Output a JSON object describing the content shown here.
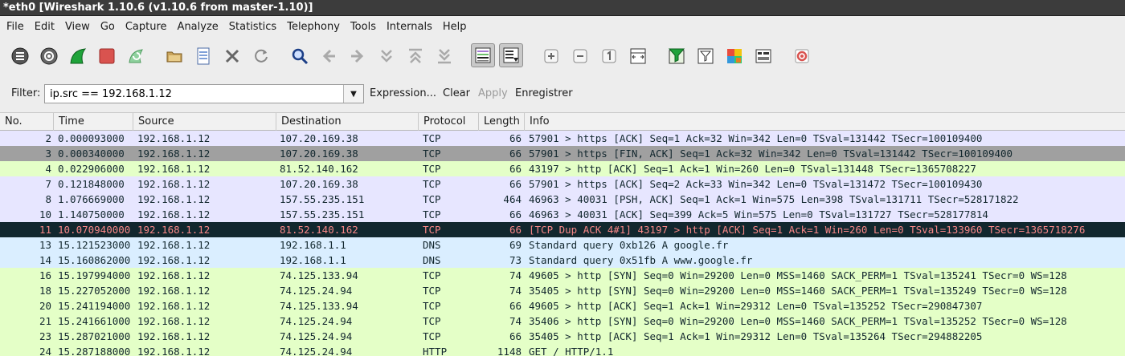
{
  "window": {
    "title": "*eth0   [Wireshark 1.10.6  (v1.10.6 from master-1.10)]"
  },
  "menu": [
    "File",
    "Edit",
    "View",
    "Go",
    "Capture",
    "Analyze",
    "Statistics",
    "Telephony",
    "Tools",
    "Internals",
    "Help"
  ],
  "toolbar": {
    "icons": [
      "interfaces-icon",
      "options-icon",
      "start-capture-icon",
      "stop-capture-icon",
      "restart-capture-icon",
      "open-file-icon",
      "save-file-icon",
      "close-file-icon",
      "reload-icon",
      "find-packet-icon",
      "go-back-icon",
      "go-forward-icon",
      "go-to-packet-icon",
      "go-first-icon",
      "go-last-icon",
      "colorize-icon",
      "autoscroll-icon",
      "zoom-in-icon",
      "zoom-out-icon",
      "normal-size-icon",
      "resize-columns-icon",
      "capture-filters-icon",
      "display-filters-icon",
      "coloring-rules-icon",
      "preferences-icon",
      "help-icon"
    ]
  },
  "filter": {
    "label": "Filter:",
    "value": "ip.src == 192.168.1.12",
    "expression_label": "Expression...",
    "clear_label": "Clear",
    "apply_label": "Apply",
    "save_label": "Enregistrer"
  },
  "packet_list": {
    "columns": [
      "No.",
      "Time",
      "Source",
      "Destination",
      "Protocol",
      "Length",
      "Info"
    ],
    "rows": [
      {
        "no": "2",
        "time": "0.000093000",
        "src": "192.168.1.12",
        "dst": "107.20.169.38",
        "proto": "TCP",
        "len": "66",
        "info": "57901 > https [ACK] Seq=1 Ack=32 Win=342 Len=0 TSval=131442 TSecr=100109400",
        "bg": "#e7e6ff",
        "fg": "#12272e"
      },
      {
        "no": "3",
        "time": "0.000340000",
        "src": "192.168.1.12",
        "dst": "107.20.169.38",
        "proto": "TCP",
        "len": "66",
        "info": "57901 > https [FIN, ACK] Seq=1 Ack=32 Win=342 Len=0 TSval=131442 TSecr=100109400",
        "bg": "#a0a0a0",
        "fg": "#12272e"
      },
      {
        "no": "4",
        "time": "0.022906000",
        "src": "192.168.1.12",
        "dst": "81.52.140.162",
        "proto": "TCP",
        "len": "66",
        "info": "43197 > http [ACK] Seq=1 Ack=1 Win=260 Len=0 TSval=131448 TSecr=1365708227",
        "bg": "#e4ffc7",
        "fg": "#12272e"
      },
      {
        "no": "7",
        "time": "0.121848000",
        "src": "192.168.1.12",
        "dst": "107.20.169.38",
        "proto": "TCP",
        "len": "66",
        "info": "57901 > https [ACK] Seq=2 Ack=33 Win=342 Len=0 TSval=131472 TSecr=100109430",
        "bg": "#e7e6ff",
        "fg": "#12272e"
      },
      {
        "no": "8",
        "time": "1.076669000",
        "src": "192.168.1.12",
        "dst": "157.55.235.151",
        "proto": "TCP",
        "len": "464",
        "info": "46963 > 40031 [PSH, ACK] Seq=1 Ack=1 Win=575 Len=398 TSval=131711 TSecr=528171822",
        "bg": "#e7e6ff",
        "fg": "#12272e"
      },
      {
        "no": "10",
        "time": "1.140750000",
        "src": "192.168.1.12",
        "dst": "157.55.235.151",
        "proto": "TCP",
        "len": "66",
        "info": "46963 > 40031 [ACK] Seq=399 Ack=5 Win=575 Len=0 TSval=131727 TSecr=528177814",
        "bg": "#e7e6ff",
        "fg": "#12272e"
      },
      {
        "no": "11",
        "time": "10.070940000",
        "src": "192.168.1.12",
        "dst": "81.52.140.162",
        "proto": "TCP",
        "len": "66",
        "info": "[TCP Dup ACK 4#1] 43197 > http [ACK] Seq=1 Ack=1 Win=260 Len=0 TSval=133960 TSecr=1365718276",
        "bg": "#12272e",
        "fg": "#f78787"
      },
      {
        "no": "13",
        "time": "15.121523000",
        "src": "192.168.1.12",
        "dst": "192.168.1.1",
        "proto": "DNS",
        "len": "69",
        "info": "Standard query 0xb126  A google.fr",
        "bg": "#daeeff",
        "fg": "#12272e"
      },
      {
        "no": "14",
        "time": "15.160862000",
        "src": "192.168.1.12",
        "dst": "192.168.1.1",
        "proto": "DNS",
        "len": "73",
        "info": "Standard query 0x51fb  A www.google.fr",
        "bg": "#daeeff",
        "fg": "#12272e"
      },
      {
        "no": "16",
        "time": "15.197994000",
        "src": "192.168.1.12",
        "dst": "74.125.133.94",
        "proto": "TCP",
        "len": "74",
        "info": "49605 > http [SYN] Seq=0 Win=29200 Len=0 MSS=1460 SACK_PERM=1 TSval=135241 TSecr=0 WS=128",
        "bg": "#e4ffc7",
        "fg": "#12272e"
      },
      {
        "no": "18",
        "time": "15.227052000",
        "src": "192.168.1.12",
        "dst": "74.125.24.94",
        "proto": "TCP",
        "len": "74",
        "info": "35405 > http [SYN] Seq=0 Win=29200 Len=0 MSS=1460 SACK_PERM=1 TSval=135249 TSecr=0 WS=128",
        "bg": "#e4ffc7",
        "fg": "#12272e"
      },
      {
        "no": "20",
        "time": "15.241194000",
        "src": "192.168.1.12",
        "dst": "74.125.133.94",
        "proto": "TCP",
        "len": "66",
        "info": "49605 > http [ACK] Seq=1 Ack=1 Win=29312 Len=0 TSval=135252 TSecr=290847307",
        "bg": "#e4ffc7",
        "fg": "#12272e"
      },
      {
        "no": "21",
        "time": "15.241661000",
        "src": "192.168.1.12",
        "dst": "74.125.24.94",
        "proto": "TCP",
        "len": "74",
        "info": "35406 > http [SYN] Seq=0 Win=29200 Len=0 MSS=1460 SACK_PERM=1 TSval=135252 TSecr=0 WS=128",
        "bg": "#e4ffc7",
        "fg": "#12272e"
      },
      {
        "no": "23",
        "time": "15.287021000",
        "src": "192.168.1.12",
        "dst": "74.125.24.94",
        "proto": "TCP",
        "len": "66",
        "info": "35405 > http [ACK] Seq=1 Ack=1 Win=29312 Len=0 TSval=135264 TSecr=294882205",
        "bg": "#e4ffc7",
        "fg": "#12272e"
      },
      {
        "no": "24",
        "time": "15.287188000",
        "src": "192.168.1.12",
        "dst": "74.125.24.94",
        "proto": "HTTP",
        "len": "1148",
        "info": "GET / HTTP/1.1",
        "bg": "#e4ffc7",
        "fg": "#12272e"
      }
    ]
  }
}
